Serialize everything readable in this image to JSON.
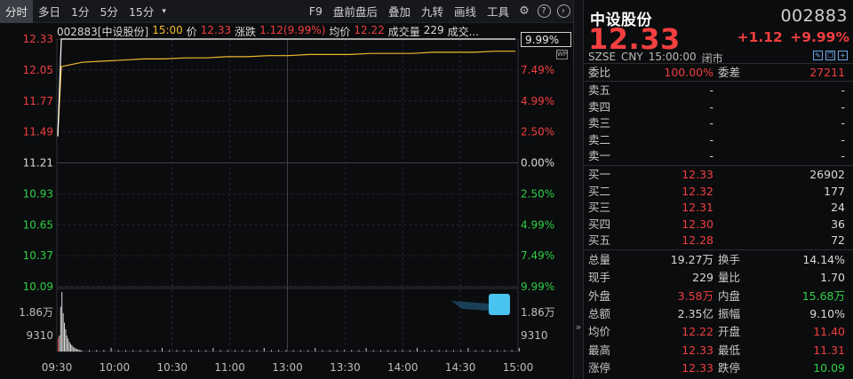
{
  "toolbar": {
    "items": [
      "分时",
      "多日",
      "1分",
      "5分",
      "15分"
    ],
    "dropdown": "▾",
    "right_items": [
      "F9",
      "盘前盘后",
      "叠加",
      "九转",
      "画线",
      "工具"
    ],
    "settings_icon": "gear-icon",
    "help_icon": "help-icon",
    "expand_icon": "chevron-right-icon"
  },
  "chart": {
    "info": {
      "code_name": "002883[中设股份]",
      "time": "15:00",
      "price_label": "价",
      "price": "12.33",
      "change_label": "涨跌",
      "change": "1.12(9.99%)",
      "avg_label": "均价",
      "avg": "12.22",
      "volume_label": "成交量",
      "volume": "229",
      "amount_label": "成交..."
    },
    "current_pct": "9.99%",
    "wp_badge": "WP",
    "collapse_glyph": "»"
  },
  "chart_data": {
    "type": "line",
    "series": [
      {
        "values": [
          11.45,
          12.08,
          12.12,
          12.13,
          12.14,
          12.15,
          12.15,
          12.16,
          12.16,
          12.17,
          12.17,
          12.18,
          12.18,
          12.19,
          12.19,
          12.19,
          12.2,
          12.2,
          12.2,
          12.21,
          12.21,
          12.21,
          12.22,
          12.22
        ]
      },
      {
        "values": [
          11.45,
          12.33,
          12.33,
          12.33,
          12.33,
          12.33,
          12.33,
          12.33,
          12.33,
          12.33,
          12.33,
          12.33,
          12.33,
          12.33,
          12.33,
          12.33,
          12.33,
          12.33,
          12.33,
          12.33,
          12.33,
          12.33,
          12.33,
          12.33
        ]
      }
    ],
    "price_ticks": [
      "12.33",
      "12.05",
      "11.77",
      "11.49",
      "11.21",
      "10.93",
      "10.65",
      "10.37",
      "10.09"
    ],
    "pct_ticks": [
      "9.99%",
      "7.49%",
      "4.99%",
      "2.50%",
      "0.00%",
      "2.50%",
      "4.99%",
      "7.49%",
      "9.99%"
    ],
    "volume_ticks": [
      "1.86万",
      "9310"
    ],
    "x_ticks": [
      "09:30",
      "10:00",
      "10:30",
      "11:00",
      "13:00",
      "13:30",
      "14:00",
      "14:30",
      "15:00"
    ],
    "ylim": [
      10.09,
      12.33
    ],
    "prev_close": 11.21,
    "volume_bars": [
      4200,
      5000,
      14000,
      18600,
      12000,
      9000,
      7000,
      5000,
      4000,
      3000,
      2400,
      2000,
      1500,
      1200,
      1000,
      800,
      600,
      500,
      400,
      300
    ],
    "volume_max": 18600
  },
  "panel": {
    "name": "中设股份",
    "code": "002883",
    "price": "12.33",
    "change": "+1.12",
    "change_pct": "+9.99%",
    "meta": [
      "SZSE",
      "CNY",
      "15:00:00",
      "闭市"
    ],
    "weibi": {
      "label": "委比",
      "value": "100.00%",
      "diff_label": "委差",
      "diff": "27211"
    },
    "sells": [
      {
        "label": "卖五",
        "price": "-",
        "vol": "-"
      },
      {
        "label": "卖四",
        "price": "-",
        "vol": "-"
      },
      {
        "label": "卖三",
        "price": "-",
        "vol": "-"
      },
      {
        "label": "卖二",
        "price": "-",
        "vol": "-"
      },
      {
        "label": "卖一",
        "price": "-",
        "vol": "-"
      }
    ],
    "buys": [
      {
        "label": "买一",
        "price": "12.33",
        "vol": "26902"
      },
      {
        "label": "买二",
        "price": "12.32",
        "vol": "177"
      },
      {
        "label": "买三",
        "price": "12.31",
        "vol": "24"
      },
      {
        "label": "买四",
        "price": "12.30",
        "vol": "36"
      },
      {
        "label": "买五",
        "price": "12.28",
        "vol": "72"
      }
    ],
    "stats": [
      {
        "l1": "总量",
        "v1": "19.27万",
        "l2": "换手",
        "v2": "14.14%",
        "c1": "wht",
        "c2": "wht"
      },
      {
        "l1": "现手",
        "v1": "229",
        "l2": "量比",
        "v2": "1.70",
        "c1": "wht",
        "c2": "wht"
      },
      {
        "l1": "外盘",
        "v1": "3.58万",
        "l2": "内盘",
        "v2": "15.68万",
        "c1": "red",
        "c2": "grn"
      },
      {
        "l1": "总额",
        "v1": "2.35亿",
        "l2": "振幅",
        "v2": "9.10%",
        "c1": "wht",
        "c2": "wht"
      },
      {
        "l1": "均价",
        "v1": "12.22",
        "l2": "开盘",
        "v2": "11.40",
        "c1": "red",
        "c2": "red"
      },
      {
        "l1": "最高",
        "v1": "12.33",
        "l2": "最低",
        "v2": "11.31",
        "c1": "red",
        "c2": "red"
      },
      {
        "l1": "涨停",
        "v1": "12.33",
        "l2": "跌停",
        "v2": "10.09",
        "c1": "red",
        "c2": "grn"
      }
    ]
  },
  "colors": {
    "up": "#f23f3f",
    "down": "#2fcf45",
    "flat": "#d8d8d8",
    "avg_line": "#f0b92e",
    "price_line": "#ffffff"
  }
}
